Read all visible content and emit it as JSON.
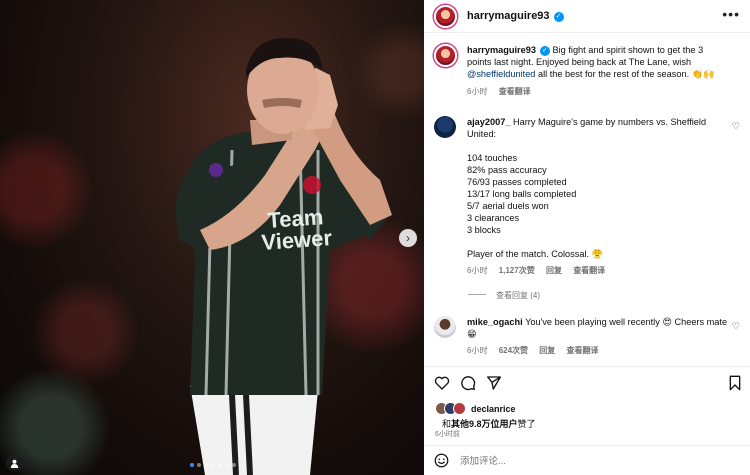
{
  "media": {
    "jersey_text_1": "Team",
    "jersey_text_2": "Viewer",
    "next_icon": "chevron-right-icon",
    "carousel_count": 7,
    "carousel_active": 1
  },
  "header": {
    "username": "harrymaguire93",
    "more_icon": "more-horizontal-icon"
  },
  "caption": {
    "username": "harrymaguire93",
    "text": "Big fight and spirit shown to get the 3 points last night. Enjoyed being back at The Lane, wish ",
    "mention": "@sheffieldunited",
    "text_end": " all the best for the rest of the season. 👏🙌",
    "time": "6小时",
    "translate": "查看翻译"
  },
  "comments": [
    {
      "username": "ajay2007_",
      "intro": "Harry Maguire's game by numbers vs. Sheffield United:",
      "stats": [
        "104 touches",
        "82% pass accuracy",
        "76/93 passes completed",
        "13/17 long balls completed",
        "5/7 aerial duels won",
        "3 clearances",
        "3 blocks"
      ],
      "closing": "Player of the match. Colossal. 😤",
      "time": "6小时",
      "likes": "1,127次赞",
      "reply": "回复",
      "translate": "查看翻译",
      "view_replies": "查看回复 (4)"
    },
    {
      "username": "mike_ogachi",
      "text": "You've been playing well recently 😍 Cheers mate 😁",
      "time": "6小时",
      "likes": "624次赞",
      "reply": "回复",
      "translate": "查看翻译"
    }
  ],
  "actions": {
    "like_icon": "heart-icon",
    "comment_icon": "comment-icon",
    "share_icon": "send-icon",
    "save_icon": "bookmark-icon"
  },
  "likes": {
    "liked_by": "declanrice",
    "summary_prefix": "和",
    "summary_bold": "其他9.8万位用户",
    "summary_suffix": "赞了"
  },
  "post_time": "6小时前",
  "add_comment": {
    "emoji_icon": "smiley-icon",
    "placeholder": "添加评论..."
  },
  "colors": {
    "accent": "#0095f6",
    "link": "#00376b",
    "muted": "#737373",
    "story_ring": "#d43f8d"
  }
}
